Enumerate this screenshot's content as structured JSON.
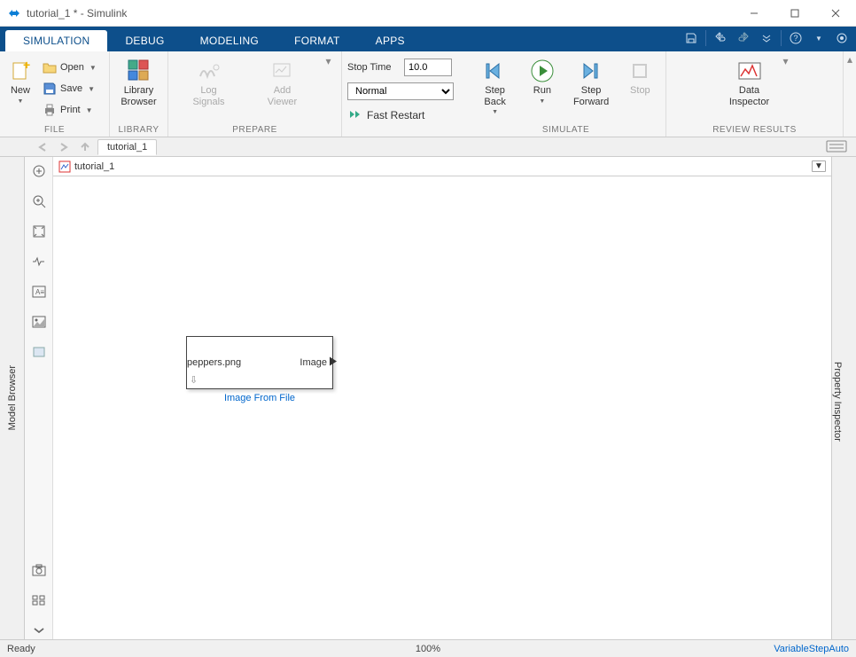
{
  "window": {
    "title": "tutorial_1 * - Simulink"
  },
  "tabs": {
    "items": [
      "SIMULATION",
      "DEBUG",
      "MODELING",
      "FORMAT",
      "APPS"
    ],
    "active": 0
  },
  "ribbon": {
    "file": {
      "new": "New",
      "open": "Open",
      "save": "Save",
      "print": "Print",
      "group": "FILE"
    },
    "library": {
      "browser": "Library\nBrowser",
      "group": "LIBRARY"
    },
    "prepare": {
      "log": "Log\nSignals",
      "viewer": "Add\nViewer",
      "group": "PREPARE"
    },
    "sim": {
      "stoptime_label": "Stop Time",
      "stoptime_value": "10.0",
      "mode": "Normal",
      "fast": "Fast Restart"
    },
    "simulate": {
      "stepback": "Step\nBack",
      "run": "Run",
      "stepfwd": "Step\nForward",
      "stop": "Stop",
      "group": "SIMULATE"
    },
    "review": {
      "insp": "Data\nInspector",
      "group": "REVIEW RESULTS"
    }
  },
  "subtabs": {
    "file": "tutorial_1"
  },
  "left_panel": "Model Browser",
  "right_panel": "Property Inspector",
  "breadcrumb": {
    "path": "tutorial_1"
  },
  "block": {
    "file": "peppers.png",
    "port": "Image",
    "label": "Image From File"
  },
  "status": {
    "left": "Ready",
    "center": "100%",
    "right": "VariableStepAuto"
  }
}
